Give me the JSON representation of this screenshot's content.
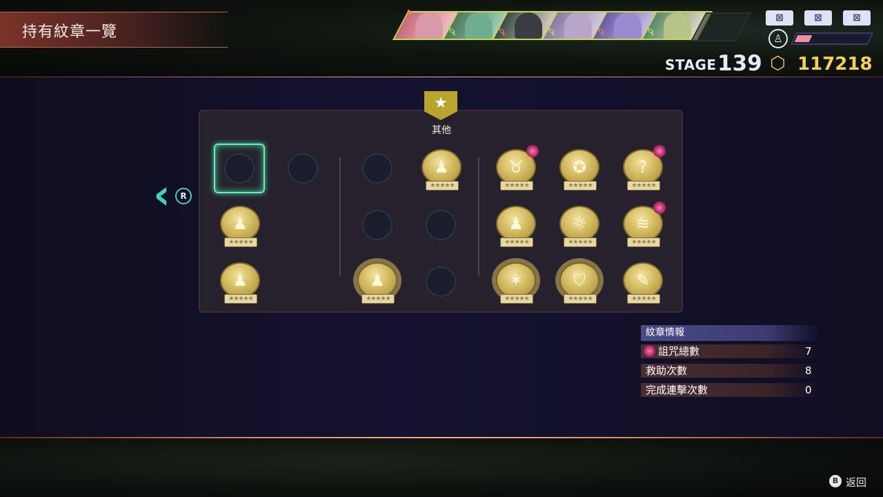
{
  "header": {
    "title": "持有紋章一覽",
    "stage_label": "STAGE",
    "stage_number": "139",
    "money": "117218",
    "cube_icon": "cube-icon",
    "target_icon": "party-target-icon",
    "gauge_level_fraction": 0.2
  },
  "party": {
    "slots": [
      {
        "mark": "♦",
        "mark_color": "red"
      },
      {
        "mark": "♀",
        "mark_color": "yellow"
      },
      {
        "mark": "♀",
        "mark_color": "red"
      },
      {
        "mark": "♀",
        "mark_color": "yellow"
      },
      {
        "mark": "♀",
        "mark_color": "red"
      },
      {
        "mark": "♀",
        "mark_color": "yellow"
      }
    ],
    "equip_slots": [
      "⊠",
      "⊠",
      "⊠"
    ]
  },
  "category": {
    "label": "其他",
    "icon": "star-icon",
    "star": "★"
  },
  "nav": {
    "prev_arrow": "‹",
    "r_button": "R"
  },
  "emblems": {
    "rank_text": "★★★★★",
    "icons": {
      "b": "♟",
      "c": "♟",
      "d": "♟",
      "e": "♟",
      "f": "♉",
      "g": "✪",
      "h": "?",
      "i": "♟",
      "j": "☼",
      "k": "≋",
      "l": "✶",
      "m": "⛉",
      "n": "✎"
    }
  },
  "info": {
    "header": "紋章情報",
    "rows": [
      {
        "label": "詛咒總數",
        "value": "7"
      },
      {
        "label": "救助次數",
        "value": "8"
      },
      {
        "label": "完成連擊次數",
        "value": "0"
      }
    ]
  },
  "footer": {
    "back_button": "B",
    "back_label": "返回"
  }
}
